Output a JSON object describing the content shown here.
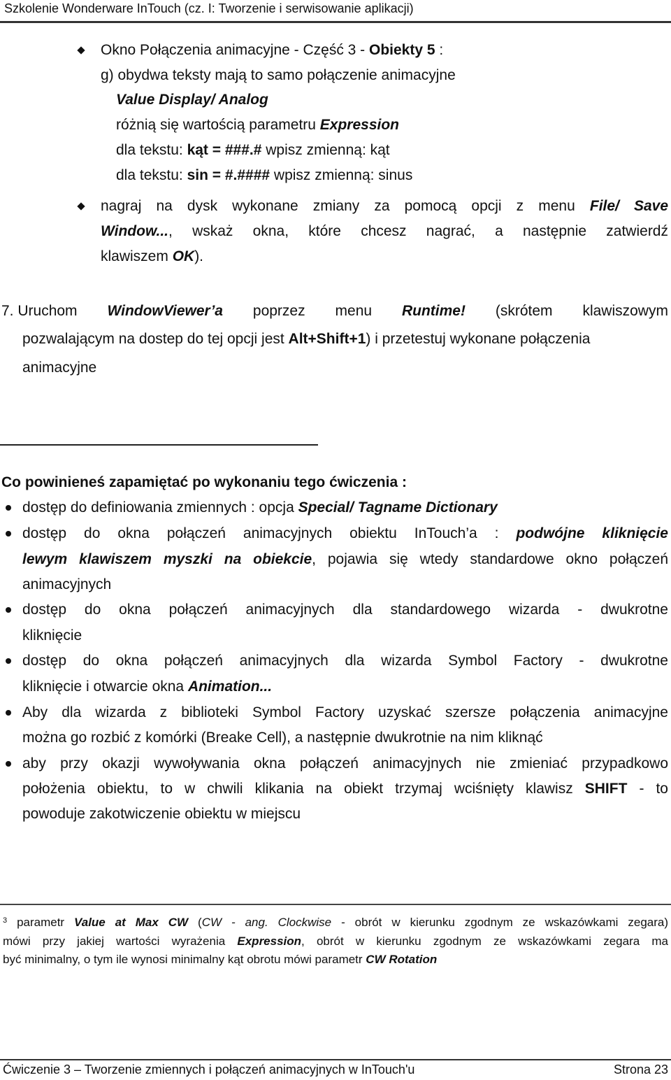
{
  "header": {
    "title": "Szkolenie Wonderware InTouch (cz. I: Tworzenie i serwisowanie aplikacji)"
  },
  "section_objects": {
    "item1": {
      "text_a": "Okno Połączenia animacyjne - Część 3 - ",
      "bold_a": "Obiekty 5",
      "text_b": " :"
    },
    "sub_g": "g) obydwa teksty mają to samo połączenie animacyjne",
    "link_type": "Value Display/ Analog",
    "differ_text": "różnią się wartością parametru ",
    "differ_param": "Expression",
    "kat_line": {
      "prefix": "dla tekstu: ",
      "format": "kąt = ###.#",
      "suffix": " wpisz zmienną: kąt"
    },
    "sin_line": {
      "prefix": "dla tekstu: ",
      "format": "sin = #.####",
      "suffix": " wpisz zmienną: sinus"
    },
    "item2": {
      "line1_text": "nagraj na dysk wykonane zmiany za pomocą opcji z menu ",
      "line1_menu": "File/ Save",
      "line2_menu": "Window...",
      "line2_text": ", wskaż okna, które chcesz nagrać, a następnie zatwierdź",
      "line3_text": "klawiszem ",
      "line3_key": "OK",
      "line3_end": ")."
    }
  },
  "step7": {
    "number": "7.",
    "w1": "Uruchom",
    "w2": "WindowViewer’a",
    "w3": "poprzez",
    "w4": "menu",
    "w5": "Runtime!",
    "w6": "(skrótem",
    "w7": "klawiszowym",
    "line2_a": "pozwalającym na dostep do tej opcji jest ",
    "line2_key": "Alt+Shift+1",
    "line2_b": ") i przetestuj wykonane połączenia",
    "line3": "animacyjne"
  },
  "summary": {
    "heading": "Co powinieneś zapamiętać po wykonaniu tego ćwiczenia :",
    "b1": {
      "text": "dostęp do definiowania zmiennych : opcja ",
      "emph": "Special/ Tagname Dictionary"
    },
    "b2": {
      "l1_text": "dostęp do okna połączeń animacyjnych obiektu InTouch’a : ",
      "l1_emph": "podwójne kliknięcie",
      "l2_emph": "lewym klawiszem myszki na obiekcie",
      "l2_text": ", pojawia się wtedy standardowe okno połączeń",
      "l3_text": "animacyjnych"
    },
    "b3": {
      "l1": "dostęp do okna połączeń animacyjnych dla standardowego wizarda - dwukrotne",
      "l2": "kliknięcie"
    },
    "b4": {
      "l1": "dostęp do okna połączeń animacyjnych dla wizarda Symbol Factory - dwukrotne",
      "l2_text": "kliknięcie i otwarcie okna ",
      "l2_emph": "Animation..."
    },
    "b5": {
      "l1": "Aby dla wizarda z biblioteki Symbol Factory uzyskać szersze połączenia animacyjne",
      "l2": "można go rozbić z komórki (Breake Cell), a następnie dwukrotnie na nim kliknąć"
    },
    "b6": {
      "l1": "aby przy okazji wywoływania okna połączeń animacyjnych nie zmieniać przypadkowo",
      "l2_text": "położenia obiektu, to w chwili klikania na obiekt trzymaj wciśnięty klawisz ",
      "l2_key": "SHIFT",
      "l2_end": " - to",
      "l3": "powoduje zakotwiczenie obiektu w miejscu"
    }
  },
  "footnote": {
    "mark": "3",
    "l1_a": " parametr ",
    "l1_param": "Value at Max CW",
    "l1_b": " (",
    "l1_cw": "CW - ",
    "l1_ang": "ang. Clockwise",
    "l1_c": " - obrót w kierunku zgodnym ze wskazówkami zegara)",
    "l2_a": "mówi przy jakiej wartości wyrażenia ",
    "l2_param": "Expression",
    "l2_b": ", obrót w kierunku zgodnym ze wskazówkami zegara ma",
    "l3_a": "być minimalny, o tym ile wynosi minimalny kąt obrotu mówi parametr ",
    "l3_param": "CW Rotation"
  },
  "footer": {
    "chapter": "Ćwiczenie 3 – Tworzenie zmiennych i połączeń animacyjnych w InTouch'u",
    "page": "Strona 23"
  }
}
